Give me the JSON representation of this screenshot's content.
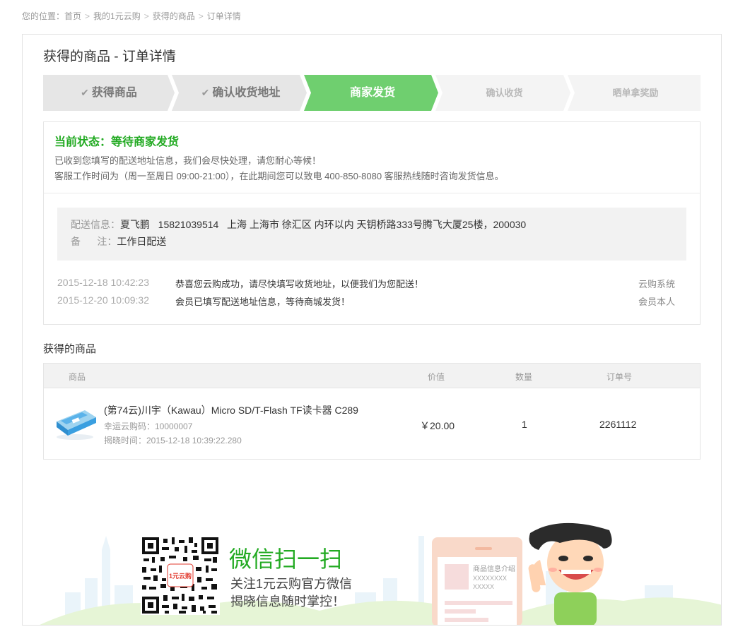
{
  "breadcrumb": {
    "items": [
      "您的位置：首页",
      "我的1元云购",
      "获得的商品",
      "订单详情"
    ],
    "sep": ">"
  },
  "page": {
    "title": "获得的商品 - 订单详情"
  },
  "steps": [
    {
      "label": "获得商品",
      "state": "done",
      "check": "✔"
    },
    {
      "label": "确认收货地址",
      "state": "done",
      "check": "✔"
    },
    {
      "label": "商家发货",
      "state": "active"
    },
    {
      "label": "确认收货",
      "state": "todo"
    },
    {
      "label": "晒单拿奖励",
      "state": "todo"
    }
  ],
  "status": {
    "title": "当前状态：等待商家发货",
    "line1": "已收到您填写的配送地址信息，我们会尽快处理，请您耐心等候！",
    "line2": "客服工作时间为（周一至周日 09:00-21:00），在此期间您可以致电 400-850-8080 客服热线随时咨询发货信息。"
  },
  "shipping": {
    "label": "配送信息：",
    "value": "夏飞鹏   15821039514   上海 上海市 徐汇区 内环以内 天钥桥路333号腾飞大厦25楼，200030",
    "note_label": "备      注：",
    "note_value": "工作日配送"
  },
  "log": [
    {
      "time": "2015-12-18 10:42:23",
      "msg": "恭喜您云购成功，请尽快填写收货地址，以便我们为您配送！",
      "who": "云购系统"
    },
    {
      "time": "2015-12-20 10:09:32",
      "msg": "会员已填写配送地址信息，等待商城发货！",
      "who": "会员本人"
    }
  ],
  "goods": {
    "section_title": "获得的商品",
    "headers": {
      "product": "商品",
      "price": "价值",
      "qty": "数量",
      "order": "订单号"
    },
    "item": {
      "name": "(第74云)川宇（Kawau）Micro SD/T-Flash TF读卡器 C289",
      "lucky_code": "幸运云购码：10000007",
      "reveal_time": "揭晓时间：2015-12-18 10:39:22.280",
      "price": "￥20.00",
      "qty": "1",
      "order": "2261112"
    }
  },
  "footer": {
    "wx_title": "微信扫一扫",
    "line1": "关注1元云购官方微信",
    "line2": "揭晓信息随时掌控！",
    "qr_logo": "1元云购",
    "card_title": "商品信息介绍",
    "card_line1": "XXXXXXXX",
    "card_line2": "XXXXX"
  },
  "colors": {
    "accent_green": "#22aa22",
    "step_active": "#6fcf6f",
    "step_done": "#e6e6e6",
    "step_todo": "#f4f4f4"
  }
}
